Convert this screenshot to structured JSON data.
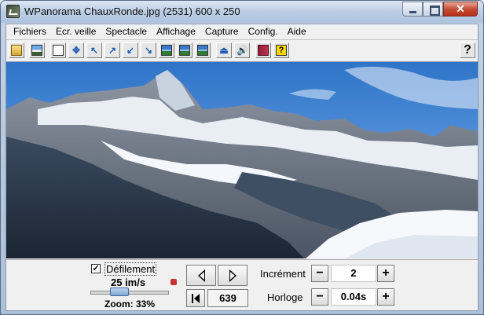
{
  "window": {
    "title": "WPanorama  ChauxRonde.jpg   (2531) 600 x 250",
    "minimize_icon": "minimize-icon",
    "maximize_icon": "maximize-icon",
    "close_glyph": "✕"
  },
  "menu": {
    "items": [
      "Fichiers",
      "Ecr. veille",
      "Spectacle",
      "Affichage",
      "Capture",
      "Config.",
      "Aide"
    ]
  },
  "toolbar": {
    "icons": [
      "open-folder-icon",
      "panorama-icon",
      "page-icon",
      "move-icon",
      "arrow-up-left-icon",
      "arrow-up-right-icon",
      "arrow-down-left-icon",
      "arrow-down-right-icon",
      "panorama-bar-1-icon",
      "panorama-bar-2-icon",
      "panorama-bar-3-icon",
      "center-icon",
      "speaker-icon",
      "book-icon",
      "help-book-icon"
    ],
    "help_label": "?"
  },
  "viewport": {
    "description_icon": "mountain-panorama-image"
  },
  "controls": {
    "scroll_checked": "✓",
    "scroll_label": "Défilement",
    "speed": "25 im/s",
    "zoom": "Zoom: 33%",
    "zoom_value": 0.33,
    "frame": "639",
    "increment_label": "Incrément",
    "increment_value": "2",
    "clock_label": "Horloge",
    "clock_value": "0.04s",
    "minus": "−",
    "plus": "+"
  }
}
